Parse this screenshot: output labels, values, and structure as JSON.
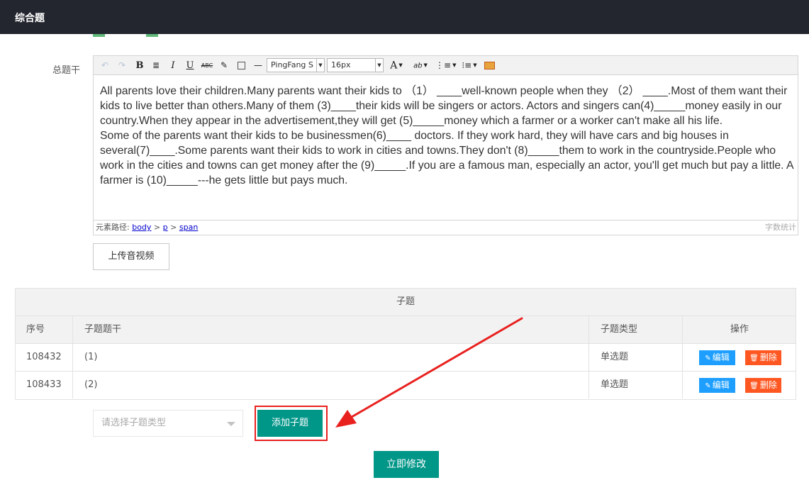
{
  "header": {
    "title": "综合题"
  },
  "form": {
    "stem_label": "总题干",
    "upload_label": "上传音视频"
  },
  "editor": {
    "font_family_value": "PingFang S",
    "font_size_value": "16px",
    "paragraph_1": "All parents love their children.Many parents want their kids to （1） ____well-known people when they （2） ____.Most of them want their kids to live better than others.Many of them (3)____their kids will be singers or actors. Actors and singers can(4)_____money easily in our country.When they appear in the advertisement,they will get (5)_____money which a farmer or a worker can't make all his life.",
    "paragraph_2": "Some of the parents want their kids to be businessmen(6)____ doctors. If they work hard, they will have cars and big houses in several(7)____.Some parents want their kids to work in cities and towns.They don't (8)_____them to work in the countryside.People who work in the cities and towns can get money after the (9)_____.If you are a famous man, especially an actor, you'll get much but pay a little. A farmer is (10)_____---he gets little but pays much.",
    "path_label": "元素路径:",
    "path": [
      "body",
      "p",
      "span"
    ],
    "path_sep": " > ",
    "word_count_label": "字数统计"
  },
  "subquestions": {
    "caption": "子题",
    "columns": [
      "序号",
      "子题题干",
      "子题类型",
      "操作"
    ],
    "rows": [
      {
        "id": "108432",
        "stem": "(1)",
        "type": "单选题"
      },
      {
        "id": "108433",
        "stem": "(2)",
        "type": "单选题"
      }
    ],
    "edit_label": "编辑",
    "delete_label": "删除",
    "type_placeholder": "请选择子题类型",
    "add_label": "添加子题"
  },
  "submit_label": "立即修改",
  "colors": {
    "primary": "#009688",
    "edit": "#1e9fff",
    "delete": "#ff5722",
    "annotation": "#e8211f",
    "header_bg": "#23262e"
  }
}
